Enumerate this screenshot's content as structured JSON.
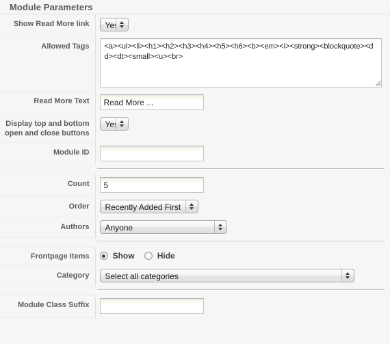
{
  "panel": {
    "title": "Module Parameters"
  },
  "fields": {
    "show_read_more": {
      "label": "Show Read More link",
      "value": "Yes"
    },
    "allowed_tags": {
      "label": "Allowed Tags",
      "value": "<a><ul><li><h1><h2><h3><h4><h5><h6><b><em><i><strong><blockquote><dd><dt><small><u><br>"
    },
    "read_more_text": {
      "label": "Read More Text",
      "value": "Read More ..."
    },
    "display_buttons": {
      "label": "Display top and bottom open and close buttons",
      "value": "Yes"
    },
    "module_id": {
      "label": "Module ID",
      "value": ""
    },
    "count": {
      "label": "Count",
      "value": "5"
    },
    "order": {
      "label": "Order",
      "value": "Recently Added First"
    },
    "authors": {
      "label": "Authors",
      "value": "Anyone"
    },
    "frontpage_items": {
      "label": "Frontpage Items",
      "options": [
        {
          "label": "Show",
          "checked": true
        },
        {
          "label": "Hide",
          "checked": false
        }
      ]
    },
    "category": {
      "label": "Category",
      "value": "Select all categories"
    },
    "module_class_suffix": {
      "label": "Module Class Suffix",
      "value": ""
    }
  }
}
